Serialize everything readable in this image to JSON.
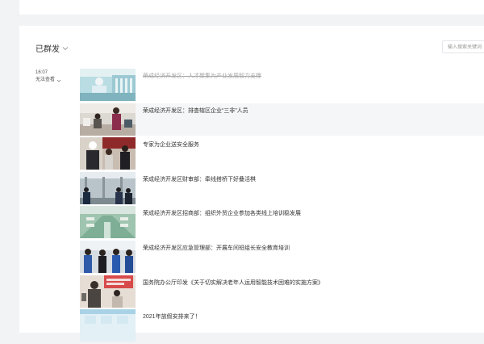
{
  "header": {
    "title": "已群发"
  },
  "search": {
    "placeholder": "输入搜索关键词"
  },
  "group": {
    "time": "16:07",
    "status": "无法查看"
  },
  "articles": [
    {
      "title": "荣成经济开发区：人才聚集为产业发展智力支撑",
      "deleted": true
    },
    {
      "title": "荣成经济开发区：排查辖区企业“三非”人员",
      "deleted": false,
      "highlighted": true
    },
    {
      "title": "专家为企业送安全服务",
      "deleted": false
    },
    {
      "title": "荣成经济开发区财审部：牵线搭桥下好叠活棋",
      "deleted": false
    },
    {
      "title": "荣成经济开发区招商部：组织外贸企业参加各类线上培训稳发展",
      "deleted": false
    },
    {
      "title": "荣成经济开发区应急管理部：开展车间班组长安全教育培训",
      "deleted": false
    },
    {
      "title": "国务院办公厅印发《关于切实解决老年人运用智能技术困难的实施方案》",
      "deleted": false
    },
    {
      "title": "2021年放假安排来了！",
      "deleted": false
    }
  ],
  "colors": {
    "background": "#f2f3f5",
    "card": "#ffffff",
    "deleted_text": "#a8a8a8",
    "text": "#333333"
  }
}
